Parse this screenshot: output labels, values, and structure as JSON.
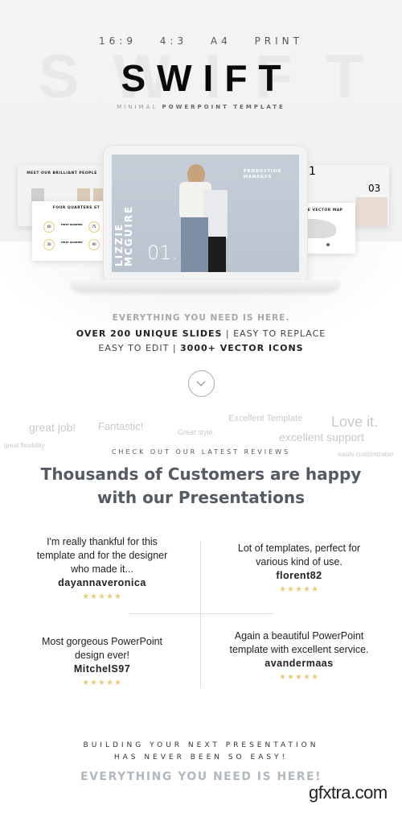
{
  "header": {
    "ratios": "16:9 4:3 A4 PRINT",
    "title": "SWIFT",
    "subtitle_light": "MINIMAL",
    "subtitle_bold": "POWERPOINT TEMPLATE"
  },
  "preview": {
    "left_back_title": "MEET OUR BRILLIANT PEOPLE",
    "left_front_title": "FOUR QUARTERS ST",
    "left_front_values": [
      "60",
      "75",
      "30",
      "90"
    ],
    "left_front_labels": [
      "FIRST QUARTER",
      "FIRST QUARTER"
    ],
    "main_name": "LIZZIE MCGUIRE",
    "main_number": "01.",
    "main_role": "PRODUCTION MANAGER",
    "right_back_number_1": "1",
    "right_back_number_2": "03",
    "right_front_title": "WORLD WIDE VECTOR MAP"
  },
  "features": {
    "tagline": "EVERYTHING YOU NEED IS HERE.",
    "line1_bold": "OVER 200 UNIQUE SLIDES",
    "line1_sep": " | ",
    "line1_rest": "EASY TO REPLACE",
    "line2_start": "EASY TO EDIT",
    "line2_sep": " | ",
    "line2_bold": "3000+ VECTOR ICONS"
  },
  "scroll_icon": "chevron-down-circle-icon",
  "word_cloud": [
    "great job!",
    "Fantastic!",
    "Great style.",
    "Excellent Template",
    "Love it.",
    "excellent support",
    "great flexibility",
    "easily customizable"
  ],
  "reviews_section": {
    "kicker": "CHECK OUT OUR LATEST REVIEWS",
    "heading_line1": "Thousands of Customers are happy",
    "heading_line2": "with our Presentations",
    "reviews": [
      {
        "text": "I'm really thankful for this template and for the designer who made it...",
        "author": "dayannaveronica",
        "stars": "★★★★★",
        "rating": 5
      },
      {
        "text": "Lot of templates, perfect for various kind of use.",
        "author": "florent82",
        "stars": "★★★★★",
        "rating": 5
      },
      {
        "text": "Most gorgeous PowerPoint design ever!",
        "author": "MitchelS97",
        "stars": "★★★★★",
        "rating": 5
      },
      {
        "text": "Again a beautiful PowerPoint template with excellent service.",
        "author": "avandermaas",
        "stars": "★★★★★",
        "rating": 5
      }
    ]
  },
  "footer": {
    "line1": "BUILDING YOUR NEXT PRESENTATION",
    "line2": "HAS NEVER BEEN SO EASY!",
    "cta": "EVERYTHING YOU NEED IS HERE!"
  },
  "watermark": "gfxtra.com",
  "colors": {
    "star": "#e6cd7f",
    "heading": "#555b63",
    "cta": "#b3b8bf"
  }
}
